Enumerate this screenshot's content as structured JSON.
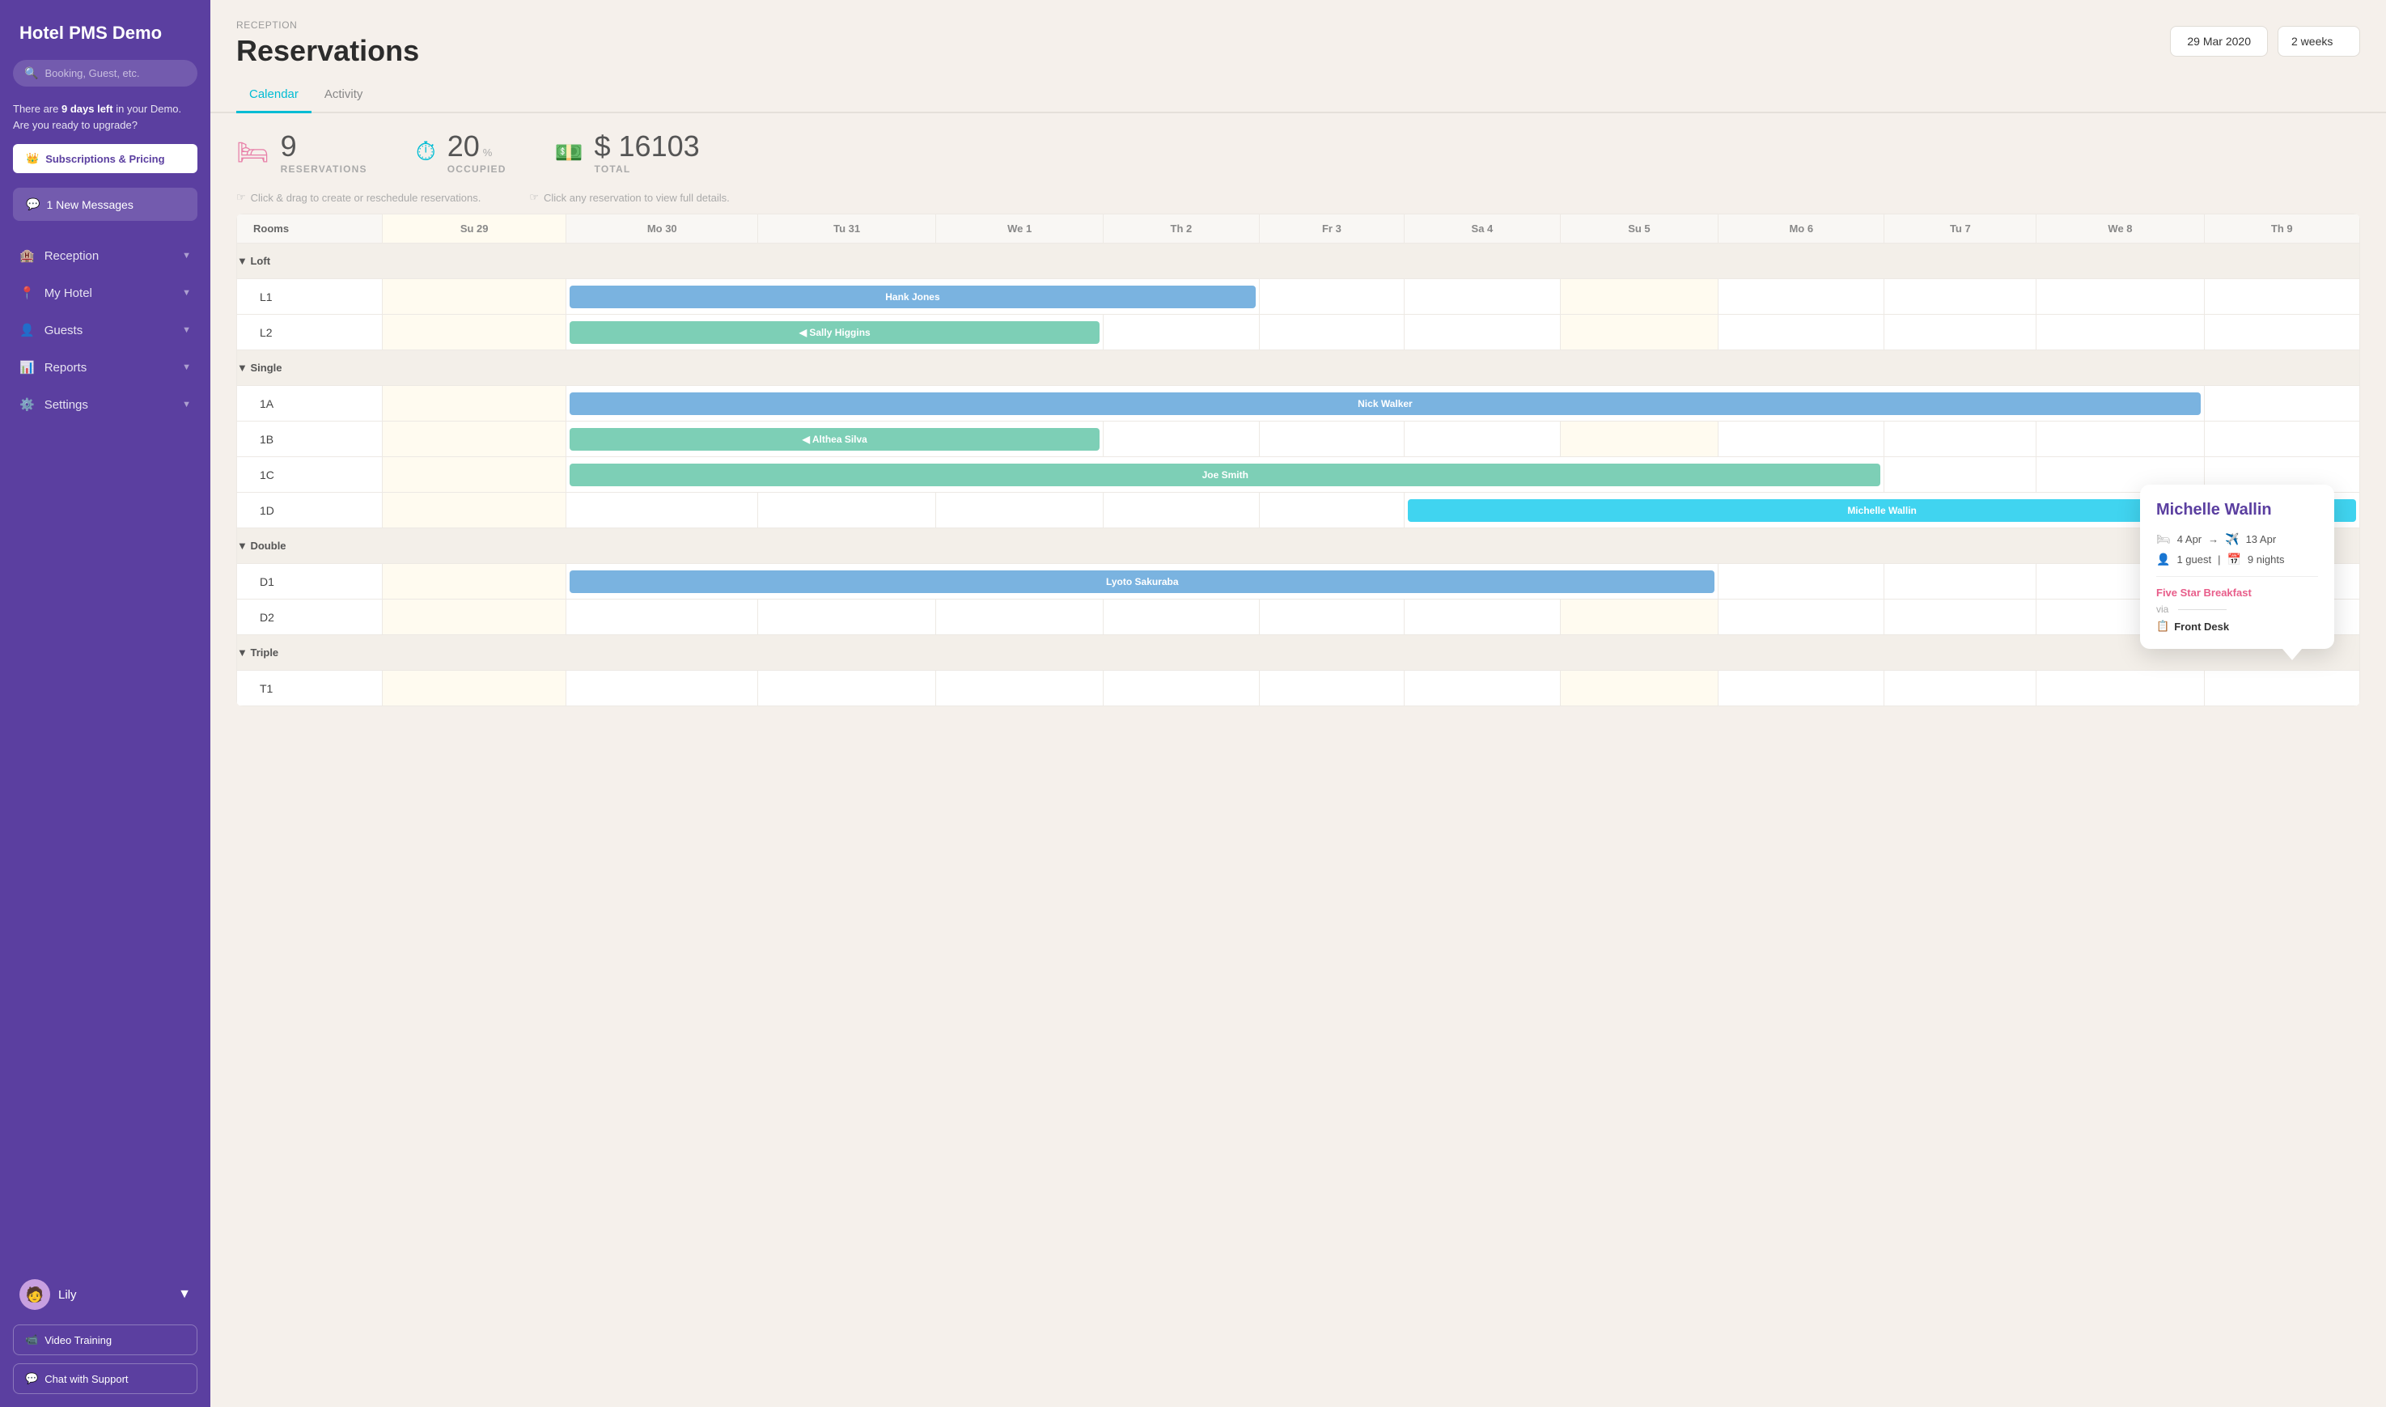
{
  "sidebar": {
    "title": "Hotel PMS Demo",
    "search_placeholder": "Booking, Guest, etc.",
    "demo_notice": "There are",
    "days_left": "9 days left",
    "demo_notice2": "in your Demo. Are you ready to upgrade?",
    "upgrade_btn": "Subscriptions & Pricing",
    "messages_btn": "1 New Messages",
    "nav_items": [
      {
        "id": "reception",
        "label": "Reception",
        "icon": "🏨"
      },
      {
        "id": "my-hotel",
        "label": "My Hotel",
        "icon": "📍"
      },
      {
        "id": "guests",
        "label": "Guests",
        "icon": "👤"
      },
      {
        "id": "reports",
        "label": "Reports",
        "icon": "📊"
      },
      {
        "id": "settings",
        "label": "Settings",
        "icon": "⚙️"
      }
    ],
    "user_name": "Lily",
    "video_training_btn": "Video Training",
    "chat_support_btn": "Chat with Support"
  },
  "header": {
    "breadcrumb": "RECEPTION",
    "title": "Reservations",
    "date": "29 Mar 2020",
    "period": "2 weeks"
  },
  "tabs": [
    {
      "id": "calendar",
      "label": "Calendar",
      "active": true
    },
    {
      "id": "activity",
      "label": "Activity",
      "active": false
    }
  ],
  "stats": [
    {
      "id": "reservations",
      "number": "9",
      "label": "RESERVATIONS",
      "icon": "🛏️",
      "icon_color": "#e87fa8"
    },
    {
      "id": "occupied",
      "number": "20",
      "unit": "%",
      "label": "OCCUPIED",
      "icon": "⏱",
      "icon_color": "#00bcd4"
    },
    {
      "id": "total",
      "number": "$ 16103",
      "label": "TOTAL",
      "icon": "💵",
      "icon_color": "#4caf8a"
    }
  ],
  "hints": [
    {
      "text": "Click & drag to create or reschedule reservations."
    },
    {
      "text": "Click any reservation to view full details."
    }
  ],
  "calendar": {
    "rooms_label": "Rooms",
    "columns": [
      {
        "id": "su29",
        "label": "Su 29",
        "today": false,
        "sunday": true
      },
      {
        "id": "mo30",
        "label": "Mo 30",
        "today": false
      },
      {
        "id": "tu31",
        "label": "Tu 31",
        "today": false
      },
      {
        "id": "we1",
        "label": "We 1",
        "today": false
      },
      {
        "id": "th2",
        "label": "Th 2",
        "today": false
      },
      {
        "id": "fr3",
        "label": "Fr 3",
        "today": false
      },
      {
        "id": "sa4",
        "label": "Sa 4",
        "today": false
      },
      {
        "id": "su5",
        "label": "Su 5",
        "today": false
      },
      {
        "id": "mo6",
        "label": "Mo 6",
        "today": false
      },
      {
        "id": "tu7",
        "label": "Tu 7",
        "today": false
      },
      {
        "id": "we8",
        "label": "We 8",
        "today": false
      },
      {
        "id": "th9",
        "label": "Th 9",
        "today": false
      }
    ],
    "groups": [
      {
        "name": "Loft",
        "rooms": [
          {
            "id": "L1",
            "bookings": [
              {
                "name": "Hank Jones",
                "start": 1,
                "span": 4,
                "color": "bar-blue"
              }
            ]
          },
          {
            "id": "L2",
            "bookings": [
              {
                "name": "Sally Higgins",
                "start": 1,
                "span": 3,
                "color": "bar-green",
                "arrow_left": true
              }
            ]
          }
        ]
      },
      {
        "name": "Single",
        "rooms": [
          {
            "id": "1A",
            "bookings": [
              {
                "name": "Nick Walker",
                "start": 1,
                "span": 10,
                "color": "bar-blue"
              }
            ]
          },
          {
            "id": "1B",
            "bookings": [
              {
                "name": "Althea Silva",
                "start": 1,
                "span": 3,
                "color": "bar-green",
                "arrow_left": true
              }
            ]
          },
          {
            "id": "1C",
            "bookings": [
              {
                "name": "Joe Smith",
                "start": 1,
                "span": 8,
                "color": "bar-green"
              }
            ]
          },
          {
            "id": "1D",
            "bookings": [
              {
                "name": "Michelle Wallin",
                "start": 6,
                "span": 7,
                "color": "bar-cyan",
                "active": true
              }
            ]
          }
        ]
      },
      {
        "name": "Double",
        "rooms": [
          {
            "id": "D1",
            "bookings": [
              {
                "name": "Lyoto Sakuraba",
                "start": 1,
                "span": 7,
                "color": "bar-blue"
              }
            ]
          },
          {
            "id": "D2",
            "bookings": []
          }
        ]
      },
      {
        "name": "Triple",
        "rooms": [
          {
            "id": "T1",
            "bookings": []
          }
        ]
      }
    ]
  },
  "tooltip": {
    "name": "Michelle Wallin",
    "checkin": "4 Apr",
    "checkout": "13 Apr",
    "guests": "1 guest",
    "nights": "9 nights",
    "package": "Five Star Breakfast",
    "via_label": "via",
    "source": "Front Desk",
    "checkin_icon": "🛏",
    "checkout_icon": "✈️",
    "guests_icon": "👤",
    "nights_icon": "📅"
  },
  "colors": {
    "sidebar_bg": "#5b3fa0",
    "accent_teal": "#00bcd4",
    "bar_blue": "#7ab3e0",
    "bar_green": "#7dcfb6",
    "bar_cyan": "#40d4f0",
    "tooltip_name": "#5b3fa0",
    "package_color": "#e85d8a"
  }
}
